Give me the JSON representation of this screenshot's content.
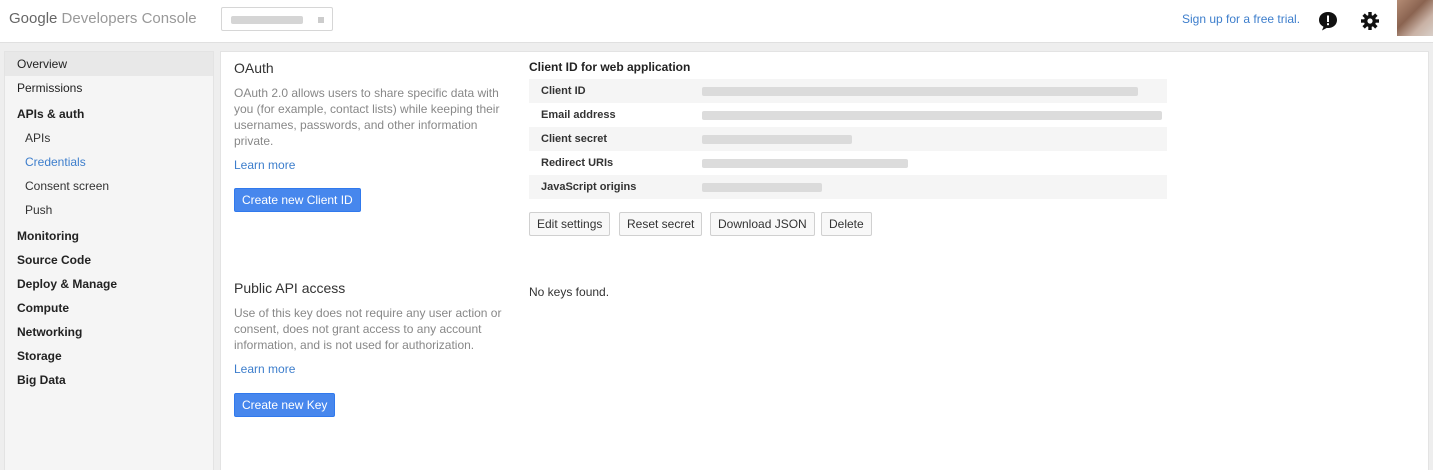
{
  "header": {
    "logo_google": "Google",
    "logo_product": "Developers Console",
    "signup_link": "Sign up for a free trial.",
    "icons": [
      "feedback-icon",
      "gear-icon"
    ]
  },
  "sidebar": {
    "items": [
      {
        "label": "Overview"
      },
      {
        "label": "Permissions"
      },
      {
        "label": "APIs & auth"
      },
      {
        "label": "APIs"
      },
      {
        "label": "Credentials"
      },
      {
        "label": "Consent screen"
      },
      {
        "label": "Push"
      },
      {
        "label": "Monitoring"
      },
      {
        "label": "Source Code"
      },
      {
        "label": "Deploy & Manage"
      },
      {
        "label": "Compute"
      },
      {
        "label": "Networking"
      },
      {
        "label": "Storage"
      },
      {
        "label": "Big Data"
      }
    ]
  },
  "oauth": {
    "title": "OAuth",
    "description": "OAuth 2.0 allows users to share specific data with you (for example, contact lists) while keeping their usernames, passwords, and other information private.",
    "learn_more": "Learn more",
    "create_button": "Create new Client ID"
  },
  "client": {
    "title": "Client ID for web application",
    "rows": [
      {
        "label": "Client ID"
      },
      {
        "label": "Email address"
      },
      {
        "label": "Client secret"
      },
      {
        "label": "Redirect URIs"
      },
      {
        "label": "JavaScript origins"
      }
    ],
    "buttons": {
      "edit": "Edit settings",
      "reset": "Reset secret",
      "download": "Download JSON",
      "delete": "Delete"
    }
  },
  "public_api": {
    "title": "Public API access",
    "description": "Use of this key does not require any user action or consent, does not grant access to any account information, and is not used for authorization.",
    "learn_more": "Learn more",
    "create_button": "Create new Key",
    "no_keys": "No keys found."
  },
  "colors": {
    "link": "#3d7ecc",
    "primary_button": "#4787ed",
    "sidebar_bg": "#f5f5f5"
  }
}
